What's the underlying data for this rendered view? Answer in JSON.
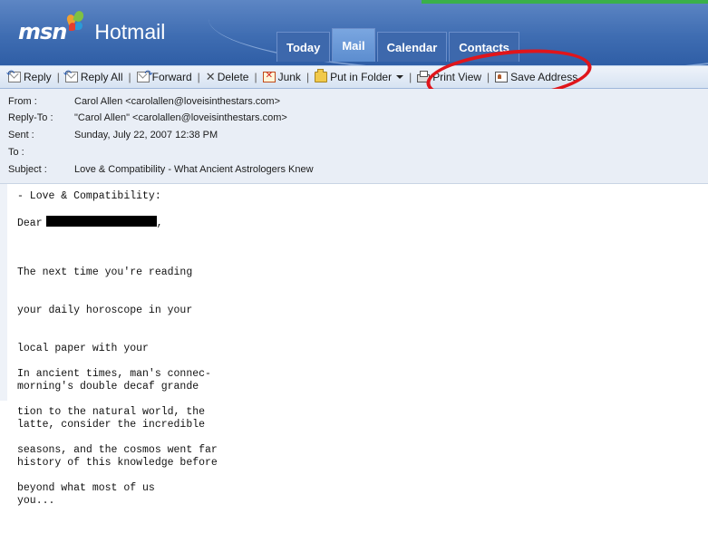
{
  "header": {
    "logo_brand": "msn",
    "product": "Hotmail",
    "tabs": [
      {
        "label": "Today",
        "active": false
      },
      {
        "label": "Mail",
        "active": true
      },
      {
        "label": "Calendar",
        "active": false
      },
      {
        "label": "Contacts",
        "active": false
      }
    ]
  },
  "toolbar": {
    "reply": "Reply",
    "reply_all": "Reply All",
    "forward": "Forward",
    "delete": "Delete",
    "junk": "Junk",
    "put_in_folder": "Put in Folder",
    "print_view": "Print View",
    "save_address": "Save Address",
    "separator": "|"
  },
  "message": {
    "from_label": "From :",
    "from_value": "Carol Allen <carolallen@loveisinthestars.com>",
    "reply_to_label": "Reply-To :",
    "reply_to_value": "\"Carol Allen\" <carolallen@loveisinthestars.com>",
    "sent_label": "Sent :",
    "sent_value": "Sunday, July 22, 2007 12:38 PM",
    "to_label": "To :",
    "to_value": "",
    "subject_label": "Subject :",
    "subject_value": "Love & Compatibility - What Ancient Astrologers Knew"
  },
  "body": {
    "heading": "- Love & Compatibility:",
    "greeting": "Dear",
    "greeting_tail": ",",
    "para1": [
      "The next time you're reading",
      "your daily horoscope in your",
      "local paper with your",
      "morning's double decaf grande",
      "latte, consider the incredible",
      "history of this knowledge before",
      "you..."
    ],
    "para2": [
      "In ancient times, man's connec-",
      "tion to the natural world, the",
      "seasons, and the cosmos went far",
      "beyond what most of us"
    ]
  },
  "colors": {
    "header_blue": "#3f6db2",
    "annotation_red": "#e0151b",
    "toolbar_bg": "#d7e3f2"
  }
}
